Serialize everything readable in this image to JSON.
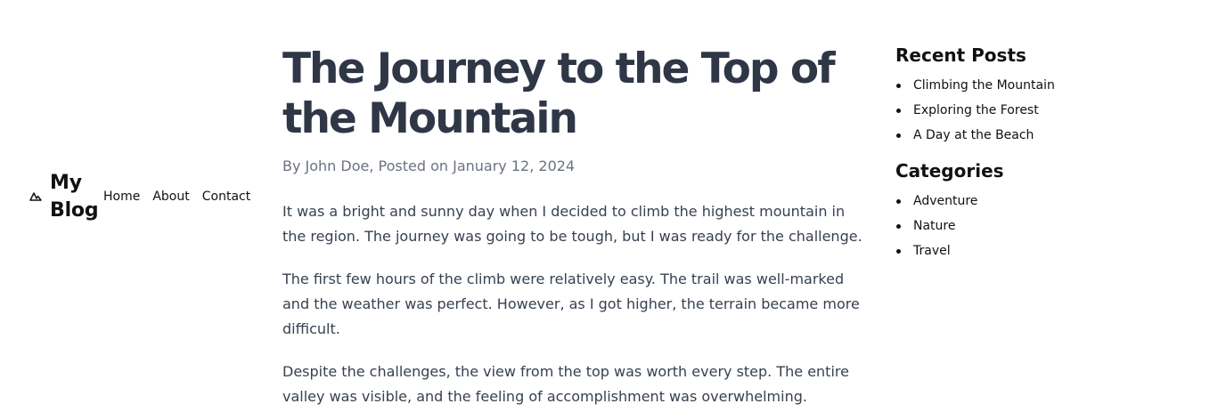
{
  "header": {
    "brand_icon": "mountain-icon",
    "brand_name": "My Blog",
    "nav": [
      "Home",
      "About",
      "Contact"
    ]
  },
  "post": {
    "title": "The Journey to the Top of the Mountain",
    "byline": "By John Doe, Posted on January 12, 2024",
    "paragraphs": [
      "It was a bright and sunny day when I decided to climb the highest mountain in the region. The journey was going to be tough, but I was ready for the challenge.",
      "The first few hours of the climb were relatively easy. The trail was well-marked and the weather was perfect. However, as I got higher, the terrain became more difficult.",
      "Despite the challenges, the view from the top was worth every step. The entire valley was visible, and the feeling of accomplishment was overwhelming."
    ]
  },
  "sidebar": {
    "recent_title": "Recent Posts",
    "recent_posts": [
      "Climbing the Mountain",
      "Exploring the Forest",
      "A Day at the Beach"
    ],
    "categories_title": "Categories",
    "categories": [
      "Adventure",
      "Nature",
      "Travel"
    ]
  },
  "colors": {
    "title": "#2f3747",
    "byline": "#6b7280",
    "body": "#374151",
    "text": "#111111"
  }
}
